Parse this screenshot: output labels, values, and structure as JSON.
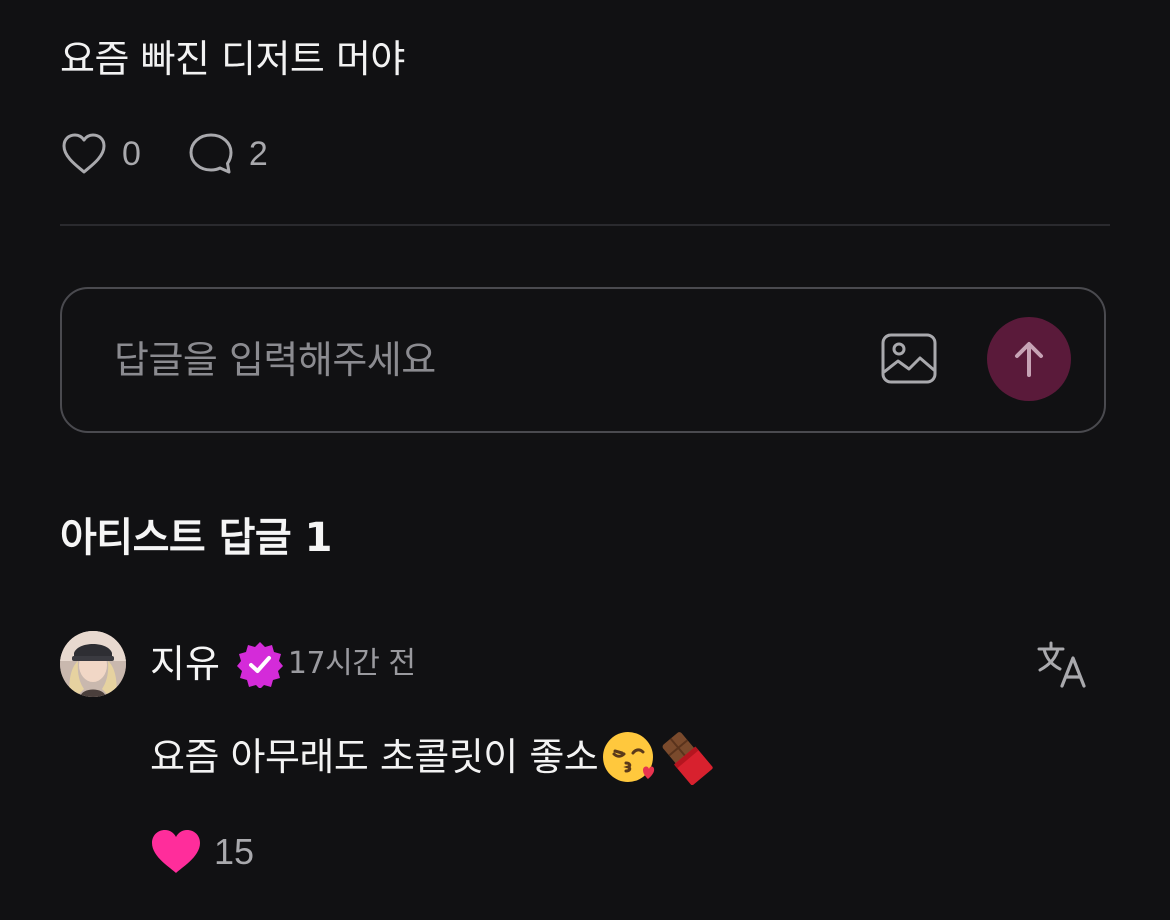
{
  "post": {
    "text": "요즘 빠진 디저트 머야",
    "likes": "0",
    "comments": "2"
  },
  "reply_input": {
    "placeholder": "답글을 입력해주세요",
    "image_icon": "image-icon",
    "send_icon": "arrow-up-icon"
  },
  "artist_replies": {
    "title": "아티스트 답글 1",
    "items": [
      {
        "author": "지유",
        "verified": true,
        "time": "17시간 전",
        "text": "요즘 아무래도 초콜릿이 좋소",
        "emojis": [
          "kissing-face-emoji",
          "chocolate-bar-emoji"
        ],
        "likes": "15",
        "translate_icon": "translate-icon"
      }
    ]
  },
  "colors": {
    "background": "#111113",
    "text_primary": "#f4f4f5",
    "text_secondary": "#a9a9ad",
    "accent_pink": "#ff2d9b",
    "verified_magenta": "#d42bd9",
    "send_button": "#5a1a3a",
    "border": "#4a4a4f"
  }
}
